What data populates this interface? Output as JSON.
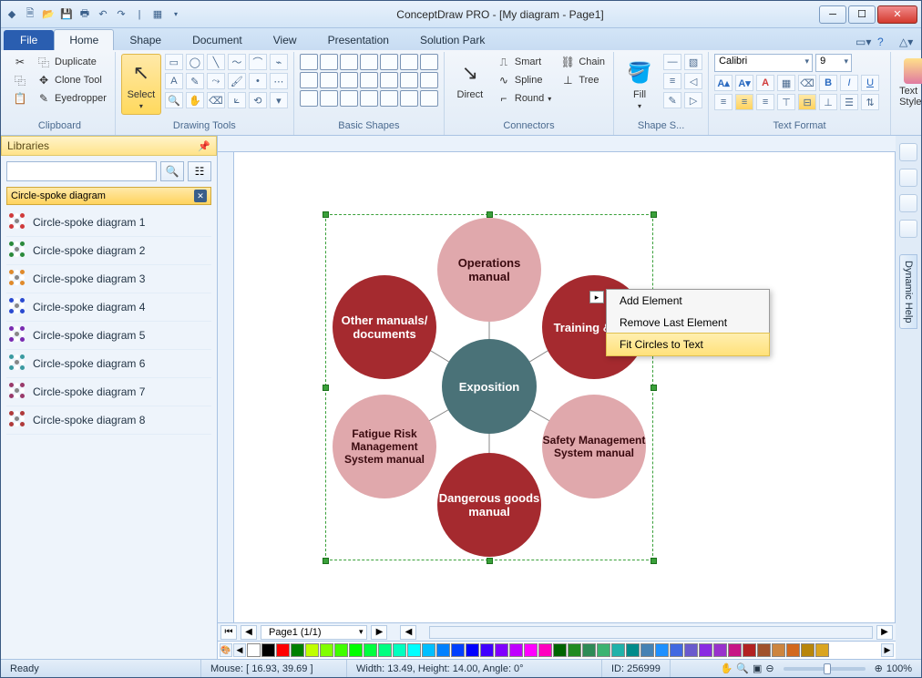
{
  "app": {
    "title": "ConceptDraw PRO - [My diagram - Page1]"
  },
  "tabs": {
    "file": "File",
    "home": "Home",
    "shape": "Shape",
    "document": "Document",
    "view": "View",
    "presentation": "Presentation",
    "solution_park": "Solution Park"
  },
  "ribbon": {
    "clipboard": {
      "label": "Clipboard",
      "duplicate": "Duplicate",
      "clone": "Clone Tool",
      "eyedropper": "Eyedropper"
    },
    "drawing": {
      "label": "Drawing Tools",
      "select": "Select"
    },
    "basic": {
      "label": "Basic Shapes"
    },
    "connectors": {
      "label": "Connectors",
      "direct": "Direct",
      "smart": "Smart",
      "spline": "Spline",
      "round": "Round ",
      "chain": "Chain",
      "tree": "Tree"
    },
    "fill": {
      "label": "Shape S...",
      "fill": "Fill"
    },
    "textformat": {
      "label": "Text Format",
      "font": "Calibri",
      "size": "9"
    },
    "textstyle": {
      "label": "Text Style"
    }
  },
  "sidebar": {
    "title": "Libraries",
    "lib_header": "Circle-spoke diagram",
    "items": [
      {
        "label": "Circle-spoke diagram 1",
        "c": "#d03a3a"
      },
      {
        "label": "Circle-spoke diagram 2",
        "c": "#2a8a3a"
      },
      {
        "label": "Circle-spoke diagram 3",
        "c": "#e08a2a"
      },
      {
        "label": "Circle-spoke diagram 4",
        "c": "#2a4ad0"
      },
      {
        "label": "Circle-spoke diagram 5",
        "c": "#7a2ab0"
      },
      {
        "label": "Circle-spoke diagram 6",
        "c": "#3a9aa0"
      },
      {
        "label": "Circle-spoke diagram 7",
        "c": "#9a3a6a"
      },
      {
        "label": "Circle-spoke diagram 8",
        "c": "#b03a3a"
      }
    ]
  },
  "diagram": {
    "center": "Exposition",
    "nodes": [
      "Operations manual",
      "Training & syll",
      "Safety Management System manual",
      "Dangerous goods manual",
      "Fatigue Risk Management System manual",
      "Other manuals/ documents"
    ]
  },
  "context_menu": {
    "add": "Add Element",
    "remove": "Remove Last Element",
    "fit": "Fit Circles to Text"
  },
  "pagebar": {
    "page": "Page1 (1/1)"
  },
  "status": {
    "ready": "Ready",
    "mouse": "Mouse: [ 16.93, 39.69 ]",
    "size": "Width: 13.49,   Height: 14.00,   Angle: 0°",
    "id": "ID: 256999",
    "zoom": "100%"
  },
  "palette": [
    "#ffffff",
    "#000000",
    "#ff0000",
    "#008000",
    "#bfff00",
    "#80ff00",
    "#40ff00",
    "#00ff00",
    "#00ff40",
    "#00ff80",
    "#00ffbf",
    "#00ffff",
    "#00bfff",
    "#0080ff",
    "#0040ff",
    "#0000ff",
    "#4000ff",
    "#8000ff",
    "#bf00ff",
    "#ff00ff",
    "#ff00bf",
    "#006400",
    "#228b22",
    "#2e8b57",
    "#3cb371",
    "#20b2aa",
    "#008b8b",
    "#4682b4",
    "#1e90ff",
    "#4169e1",
    "#6a5acd",
    "#8a2be2",
    "#9932cc",
    "#c71585",
    "#b22222",
    "#a0522d",
    "#cd853f",
    "#d2691e",
    "#b8860b",
    "#daa520"
  ]
}
